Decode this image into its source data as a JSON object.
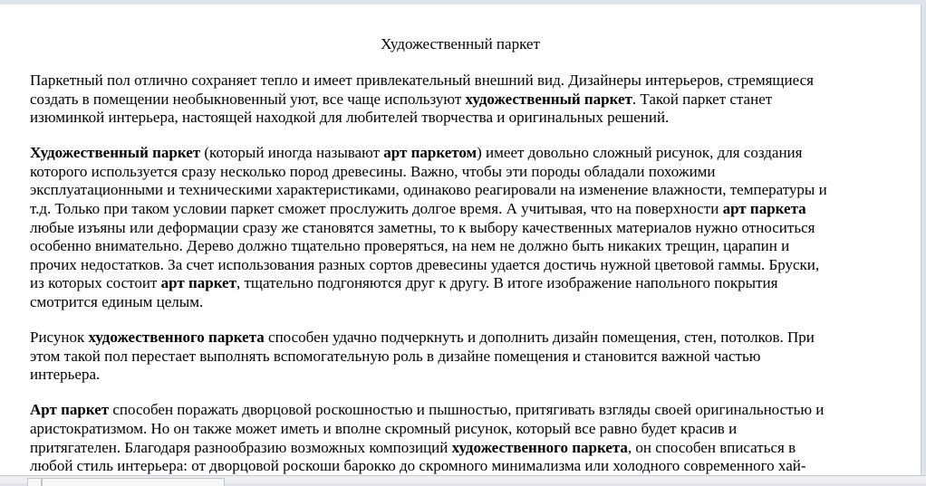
{
  "document": {
    "title": "Художественный паркет",
    "paragraphs": [
      [
        [
          [
            "Паркетный пол отлично сохраняет тепло и имеет привлекательный внешний вид. Дизайнеры интерьеров, стремящиеся",
            false
          ]
        ],
        [
          [
            "создать в помещении необыкновенный уют, все чаще используют ",
            false
          ],
          [
            "художественный паркет",
            true
          ],
          [
            ". Такой паркет станет",
            false
          ]
        ],
        [
          [
            "изюминкой интерьера, настоящей находкой для любителей творчества и оригинальных решений.",
            false
          ]
        ]
      ],
      [
        [
          [
            "Художественный паркет",
            true
          ],
          [
            " (который иногда называют ",
            false
          ],
          [
            "арт паркетом",
            true
          ],
          [
            ") имеет довольно сложный рисунок, для создания",
            false
          ]
        ],
        [
          [
            "которого используется сразу несколько пород древесины. Важно, чтобы эти породы обладали похожими",
            false
          ]
        ],
        [
          [
            "эксплуатационными и техническими характеристиками, одинаково реагировали на изменение влажности, температуры и",
            false
          ]
        ],
        [
          [
            "т.д. Только при таком условии паркет сможет прослужить долгое время. А учитывая, что на поверхности ",
            false
          ],
          [
            "арт паркета",
            true
          ]
        ],
        [
          [
            "любые изъяны или деформации сразу же становятся заметны, то к выбору качественных материалов нужно относиться",
            false
          ]
        ],
        [
          [
            "особенно внимательно. Дерево должно тщательно проверяться, на нем не должно быть никаких трещин, царапин и",
            false
          ]
        ],
        [
          [
            "прочих недостатков. За счет использования разных сортов древесины удается достичь нужной цветовой гаммы. Бруски,",
            false
          ]
        ],
        [
          [
            "из которых состоит ",
            false
          ],
          [
            "арт паркет",
            true
          ],
          [
            ", тщательно подгоняются друг к другу. В итоге изображение напольного покрытия",
            false
          ]
        ],
        [
          [
            "смотрится единым целым.",
            false
          ]
        ]
      ],
      [
        [
          [
            "Рисунок ",
            false
          ],
          [
            "художественного паркета",
            true
          ],
          [
            " способен удачно подчеркнуть и дополнить дизайн помещения, стен, потолков. При",
            false
          ]
        ],
        [
          [
            "этом такой пол перестает выполнять вспомогательную роль в дизайне помещения и становится важной частью",
            false
          ]
        ],
        [
          [
            "интерьера.",
            false
          ]
        ]
      ],
      [
        [
          [
            "Арт паркет",
            true
          ],
          [
            " способен поражать дворцовой роскошностью и пышностью, притягивать взгляды своей оригинальностью и",
            false
          ]
        ],
        [
          [
            "аристократизмом. Но он также может иметь и вполне скромный рисунок, который все равно будет красив и",
            false
          ]
        ],
        [
          [
            "притягателен. Благодаря разнообразию возможных композиций ",
            false
          ],
          [
            "художественного паркета",
            true
          ],
          [
            ", он способен вписаться в",
            false
          ]
        ],
        [
          [
            "любой стиль интерьера: от дворцовой роскоши барокко до скромного минимализма или холодного современного хай-",
            false
          ]
        ]
      ]
    ]
  }
}
